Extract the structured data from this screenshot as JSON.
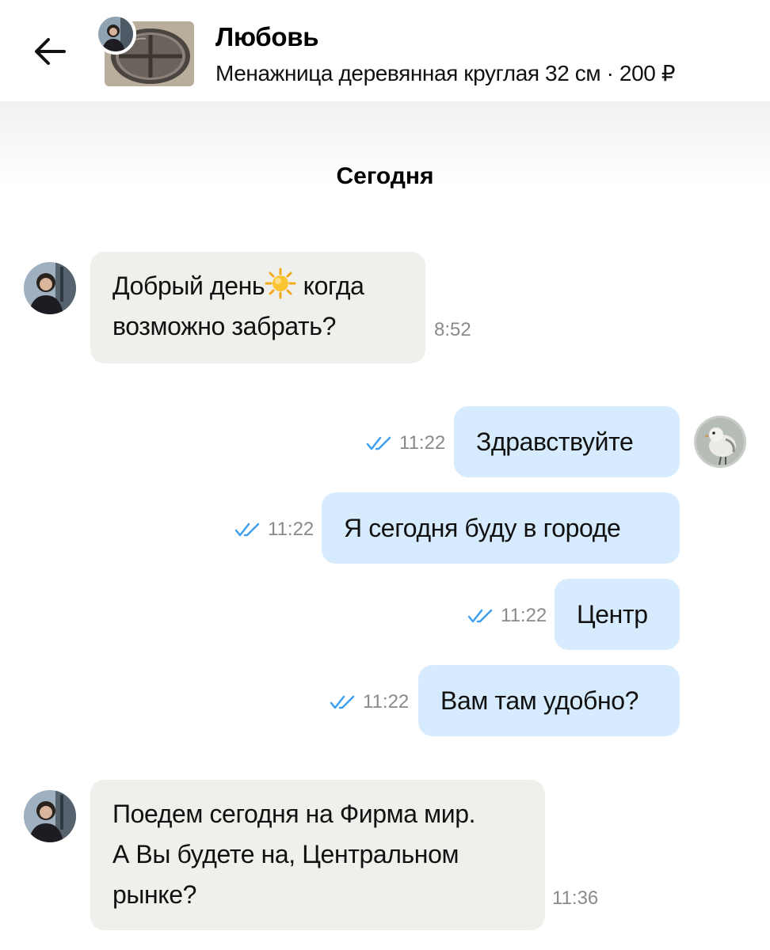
{
  "header": {
    "name": "Любовь",
    "subtitle": "Менажница деревянная круглая 32 см · 200 ₽"
  },
  "date_separator": "Сегодня",
  "messages": [
    {
      "direction": "incoming",
      "lines": [
        "Добрый день",
        "когда",
        "возможно забрать?"
      ],
      "time": "8:52",
      "emoji": "sun"
    },
    {
      "direction": "outgoing",
      "text": "Здравствуйте",
      "time": "11:22",
      "status": "read"
    },
    {
      "direction": "outgoing",
      "text": "Я сегодня буду в городе",
      "time": "11:22",
      "status": "read"
    },
    {
      "direction": "outgoing",
      "text": "Центр",
      "time": "11:22",
      "status": "read"
    },
    {
      "direction": "outgoing",
      "text": "Вам там удобно?",
      "time": "11:22",
      "status": "read"
    },
    {
      "direction": "incoming",
      "lines": [
        "Поедем сегодня на Фирма мир.",
        "А Вы будете на, Центральном",
        "рынке?"
      ],
      "time": "11:36"
    }
  ],
  "colors": {
    "incoming_bubble": "#efefec",
    "outgoing_bubble": "#d6ebfd",
    "read_checks": "#3ea0f0",
    "time_text": "#8a8a8a"
  },
  "icons": {
    "back": "arrow-left-icon",
    "read_status": "double-check-icon",
    "emoji": "sun-emoji-icon"
  }
}
